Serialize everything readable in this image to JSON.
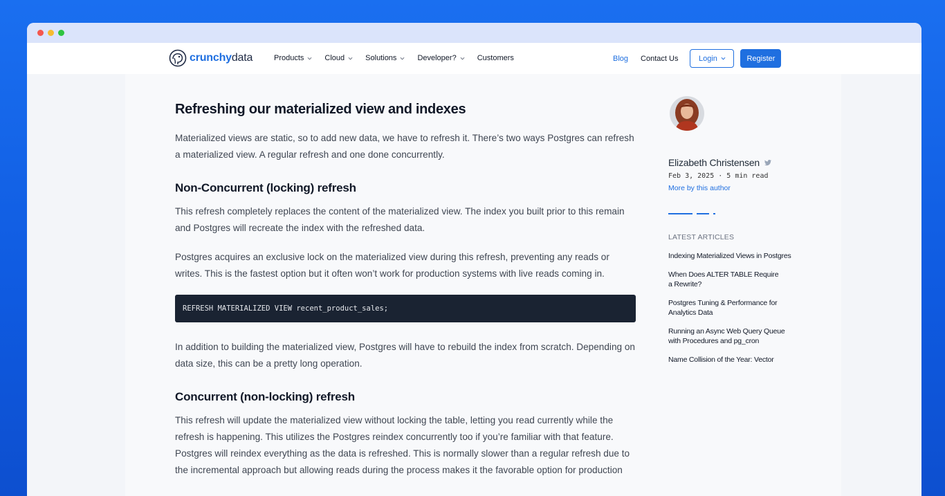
{
  "brand": {
    "name_part1": "crunchy",
    "name_part2": "data"
  },
  "nav": {
    "items": [
      {
        "label": "Products",
        "has_dropdown": true
      },
      {
        "label": "Cloud",
        "has_dropdown": true
      },
      {
        "label": "Solutions",
        "has_dropdown": true
      },
      {
        "label": "Developer?",
        "has_dropdown": true
      },
      {
        "label": "Customers",
        "has_dropdown": false
      }
    ],
    "blog": "Blog",
    "contact": "Contact Us",
    "login": "Login",
    "register": "Register"
  },
  "article": {
    "title": "Refreshing our materialized view and indexes",
    "intro": "Materialized views are static, so to add new data, we have to refresh it. There’s two ways Postgres can refresh a materialized view. A regular refresh and one done concurrently.",
    "section1_heading": "Non-Concurrent (locking) refresh",
    "section1_p1": "This refresh completely replaces the content of the materialized view. The index you built prior to this remain and Postgres will recreate the index with the refreshed data.",
    "section1_p2": "Postgres acquires an exclusive lock on the materialized view during this refresh, preventing any reads or writes. This is the fastest option but it often won’t work for production systems with live reads coming in.",
    "code": "REFRESH MATERIALIZED VIEW recent_product_sales;",
    "section1_p3": "In addition to building the materialized view, Postgres will have to rebuild the index from scratch. Depending on data size, this can be a pretty long operation.",
    "section2_heading": "Concurrent (non-locking) refresh",
    "section2_p1": "This refresh will update the materialized view without locking the table, letting you read currently while the refresh is happening. This utilizes the Postgres reindex concurrently too if you’re familiar with that feature. Postgres will reindex everything as the data is refreshed. This is normally slower than a regular refresh due to the incremental approach but allowing reads during the process makes it the favorable option for production"
  },
  "sidebar": {
    "author_name": "Elizabeth Christensen",
    "post_meta": "Feb 3, 2025 · 5 min read",
    "more_link": "More by this author",
    "latest_heading": "LATEST ARTICLES",
    "latest_articles": [
      "Indexing Materialized Views in Postgres",
      "When Does ALTER TABLE Require a Rewrite?",
      "Postgres Tuning & Performance for Analytics Data",
      "Running an Async Web Query Queue with Procedures and pg_cron",
      "Name Collision of the Year: Vector"
    ]
  },
  "colors": {
    "accent": "#1f6fe0",
    "code_bg": "#1a2332",
    "text": "#111827"
  }
}
